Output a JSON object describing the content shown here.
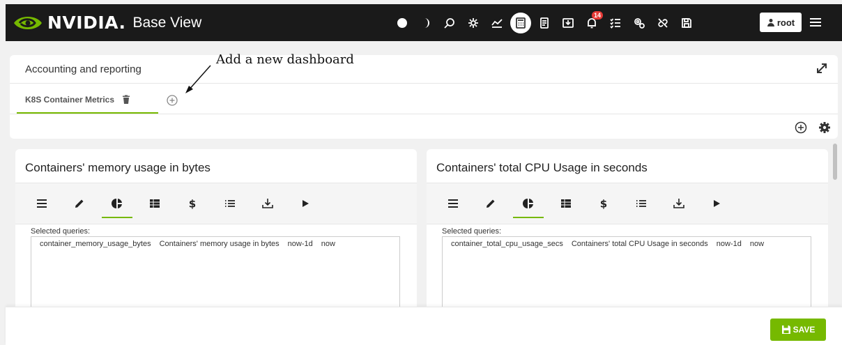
{
  "header": {
    "brand_name": "NVIDIA.",
    "product_name": "Base View",
    "notification_count": "14",
    "user_label": "root",
    "icons": [
      "light-mode-icon",
      "dark-mode-icon",
      "search-icon",
      "cluster-icon",
      "monitoring-icon",
      "calculator-icon",
      "report-icon",
      "download-icon",
      "bell-icon",
      "tasks-icon",
      "settings-icon",
      "unlink-icon",
      "save-icon"
    ]
  },
  "dashboard": {
    "title": "Accounting and reporting",
    "tab_label": "K8S Container Metrics"
  },
  "annotation": {
    "text": "Add a new dashboard"
  },
  "panels": [
    {
      "title": "Containers' memory usage in bytes",
      "selected_label": "Selected queries:",
      "query": {
        "name": "container_memory_usage_bytes",
        "description": "Containers' memory usage in bytes",
        "start": "now-1d",
        "end": "now"
      }
    },
    {
      "title": "Containers' total CPU Usage in seconds",
      "selected_label": "Selected queries:",
      "query": {
        "name": "container_total_cpu_usage_secs",
        "description": "Containers' total CPU Usage in seconds",
        "start": "now-1d",
        "end": "now"
      }
    }
  ],
  "footer": {
    "save_label": "SAVE"
  },
  "colors": {
    "accent": "#76b900",
    "topbar": "#1a1a1a",
    "badge": "#e53935"
  }
}
